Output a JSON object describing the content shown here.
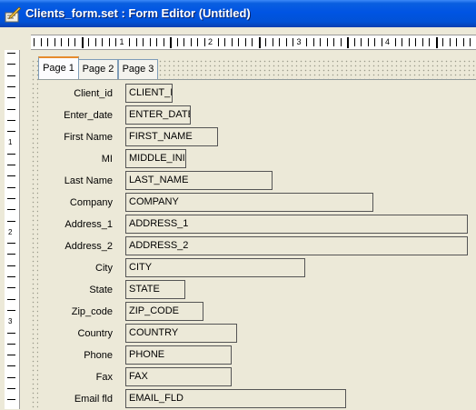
{
  "window": {
    "title": "Clients_form.set : Form Editor (Untitled)",
    "title_icon": "form-editor-icon"
  },
  "ruler": {
    "horizontal_numbers": [
      "1",
      "2",
      "3",
      "4"
    ],
    "vertical_numbers": [
      "1",
      "2",
      "3"
    ]
  },
  "tabs": [
    {
      "label": "Page 1",
      "active": true
    },
    {
      "label": "Page 2",
      "active": false
    },
    {
      "label": "Page 3",
      "active": false
    }
  ],
  "fields": [
    {
      "label": "Client_id",
      "value": "CLIENT_ID"
    },
    {
      "label": "Enter_date",
      "value": "ENTER_DATE"
    },
    {
      "label": "First Name",
      "value": "FIRST_NAME"
    },
    {
      "label": "MI",
      "value": "MIDDLE_INITIAL"
    },
    {
      "label": "Last Name",
      "value": "LAST_NAME"
    },
    {
      "label": "Company",
      "value": "COMPANY"
    },
    {
      "label": "Address_1",
      "value": "ADDRESS_1"
    },
    {
      "label": "Address_2",
      "value": "ADDRESS_2"
    },
    {
      "label": "City",
      "value": "CITY"
    },
    {
      "label": "State",
      "value": "STATE"
    },
    {
      "label": "Zip_code",
      "value": "ZIP_CODE"
    },
    {
      "label": "Country",
      "value": "COUNTRY"
    },
    {
      "label": "Phone",
      "value": "PHONE"
    },
    {
      "label": "Fax",
      "value": "FAX"
    },
    {
      "label": "Email fld",
      "value": "EMAIL_FLD"
    }
  ]
}
